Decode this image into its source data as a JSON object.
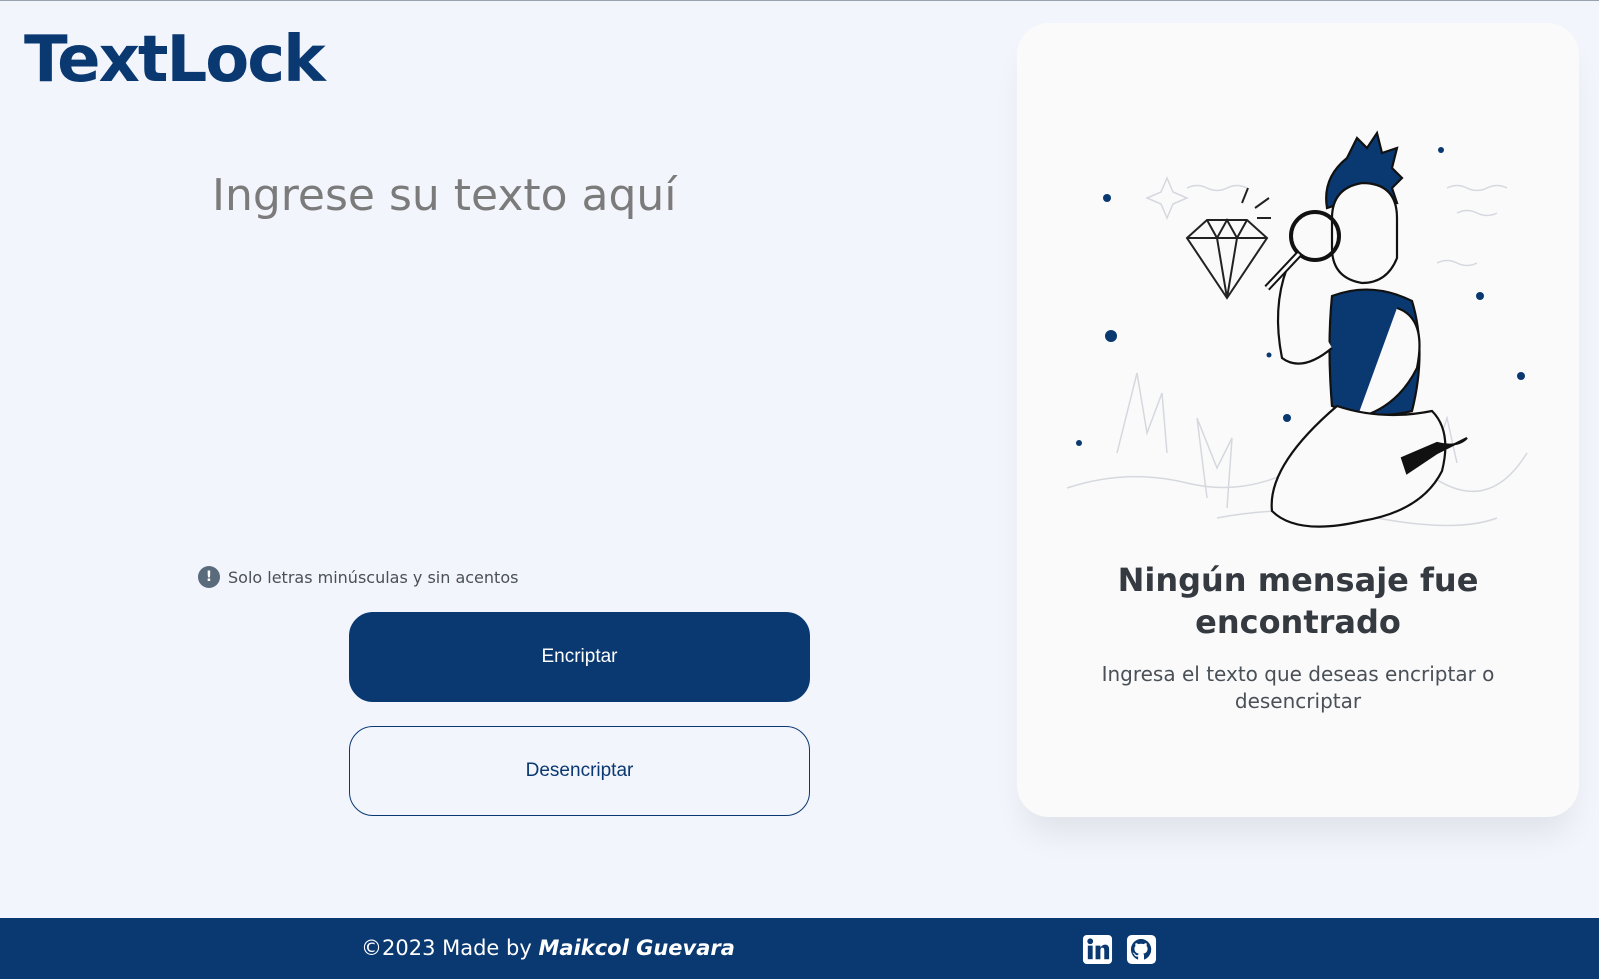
{
  "header": {
    "logo_text": "TextLock"
  },
  "editor": {
    "placeholder": "Ingrese su texto aquí",
    "hint": "Solo letras minúsculas y sin acentos",
    "hint_icon": "exclamation-icon"
  },
  "actions": {
    "encrypt_label": "Encriptar",
    "decrypt_label": "Desencriptar"
  },
  "result_panel": {
    "title": "Ningún mensaje fue encontrado",
    "description": "Ingresa el texto que deseas encriptar o desencriptar",
    "illustration": "person-with-magnifying-glass-and-diamond"
  },
  "footer": {
    "copyright_prefix": "©2023 Made by",
    "author": "Maikcol Guevara",
    "social": [
      "linkedin-icon",
      "github-icon"
    ]
  },
  "colors": {
    "primary": "#0a3871",
    "background": "#f3f5fc",
    "card": "#fafafa",
    "text_dark": "#343a40",
    "text_muted": "#495057",
    "placeholder": "#7b7b7b"
  }
}
